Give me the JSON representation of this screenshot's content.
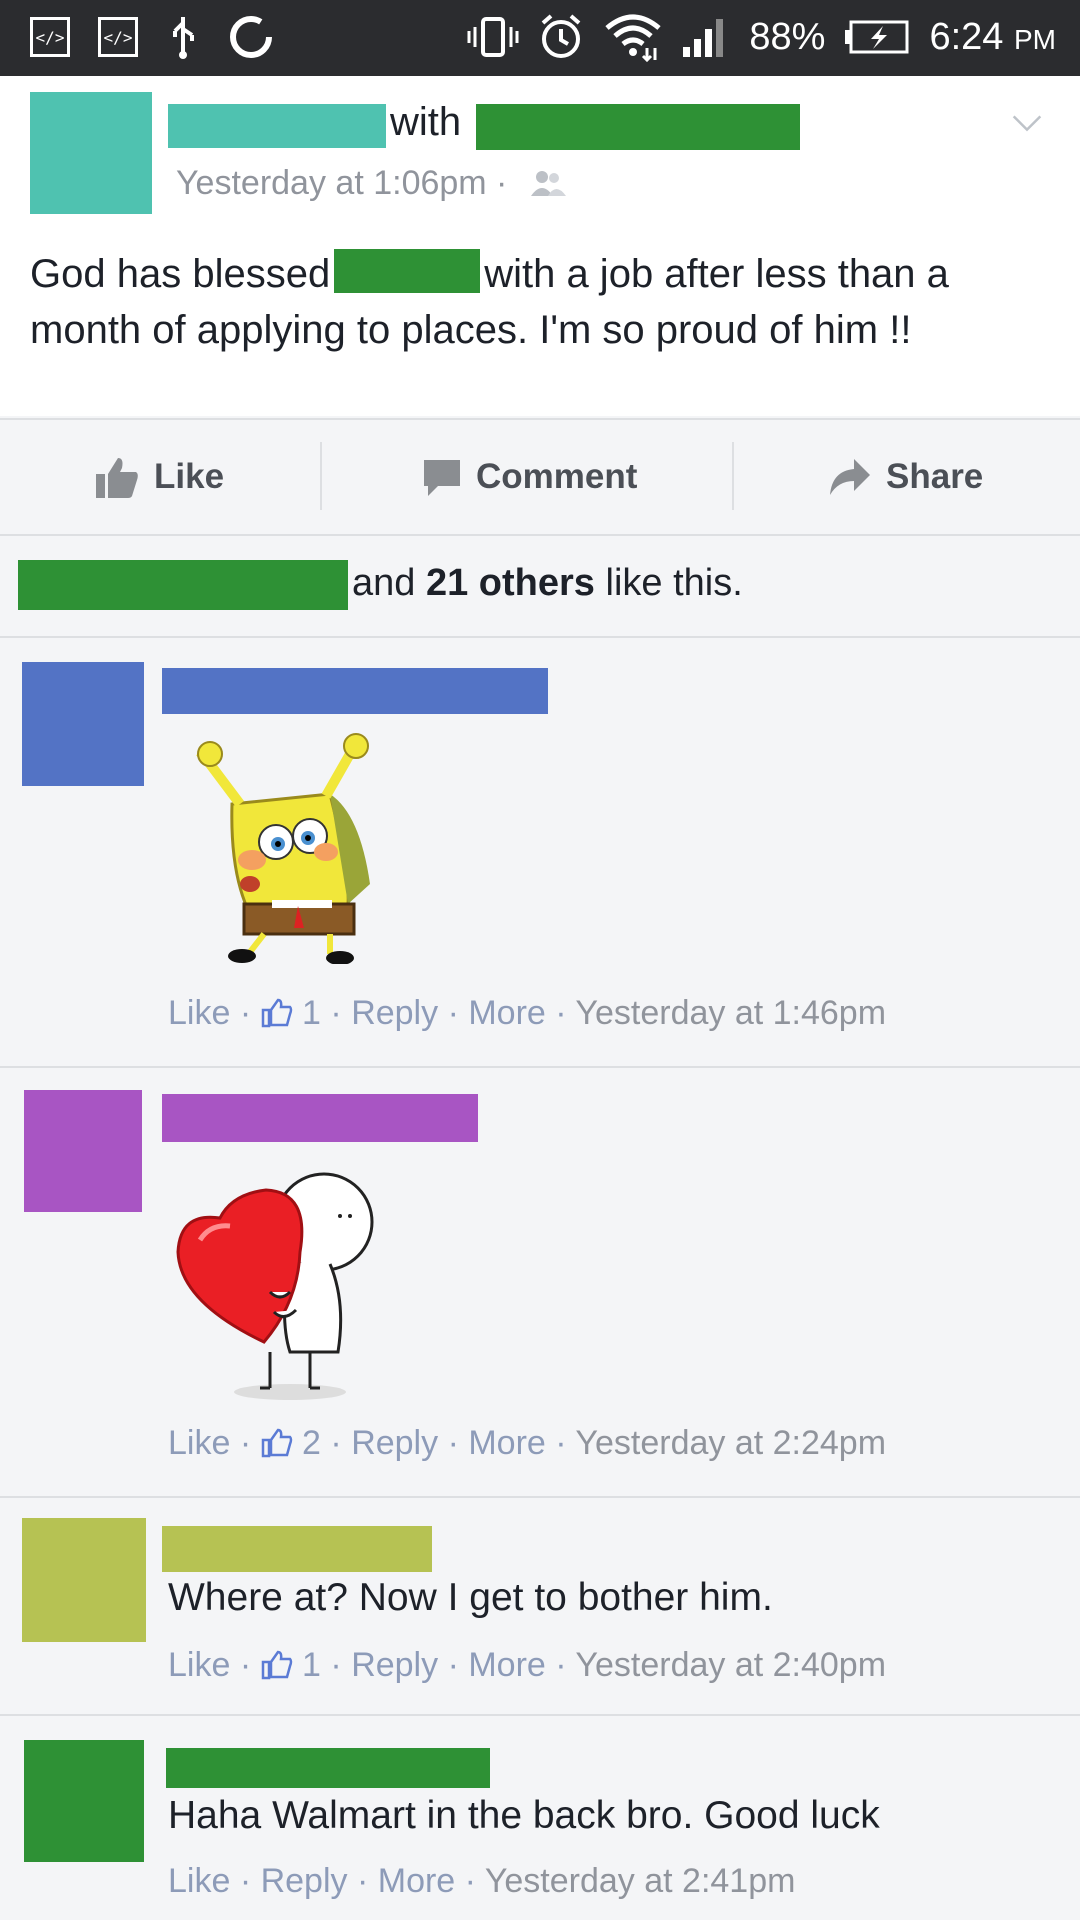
{
  "status_bar": {
    "left_icons": [
      "code-icon",
      "code-icon",
      "usb-icon",
      "sync-icon"
    ],
    "battery": "88%",
    "time": "6:24",
    "ampm": "PM"
  },
  "post": {
    "with_label": "with",
    "timestamp": "Yesterday at 1:06pm ·",
    "text_before": "God has blessed",
    "text_after": "with a job after less than a month of applying to places. I'm so proud of him !!",
    "avatar_color": "#4fc2b0"
  },
  "actions": {
    "like": "Like",
    "comment": "Comment",
    "share": "Share"
  },
  "likes_summary": {
    "and": "and",
    "others": "21 others",
    "suffix": "like this."
  },
  "comments": [
    {
      "avatar_color": "#5373c5",
      "sticker": "spongebob-sticker",
      "like": "Like",
      "like_count": "1",
      "reply": "Reply",
      "more": "More",
      "time": "Yesterday at 1:46pm"
    },
    {
      "avatar_color": "#a855c3",
      "sticker": "heart-hug-sticker",
      "like": "Like",
      "like_count": "2",
      "reply": "Reply",
      "more": "More",
      "time": "Yesterday at 2:24pm"
    },
    {
      "avatar_color": "#b6c253",
      "text": "Where at? Now I get to bother him.",
      "like": "Like",
      "like_count": "1",
      "reply": "Reply",
      "more": "More",
      "time": "Yesterday at 2:40pm"
    },
    {
      "avatar_color": "#2e9135",
      "text": "Haha Walmart in the back bro. Good luck",
      "like": "Like",
      "reply": "Reply",
      "more": "More",
      "time": "Yesterday at 2:41pm"
    }
  ]
}
